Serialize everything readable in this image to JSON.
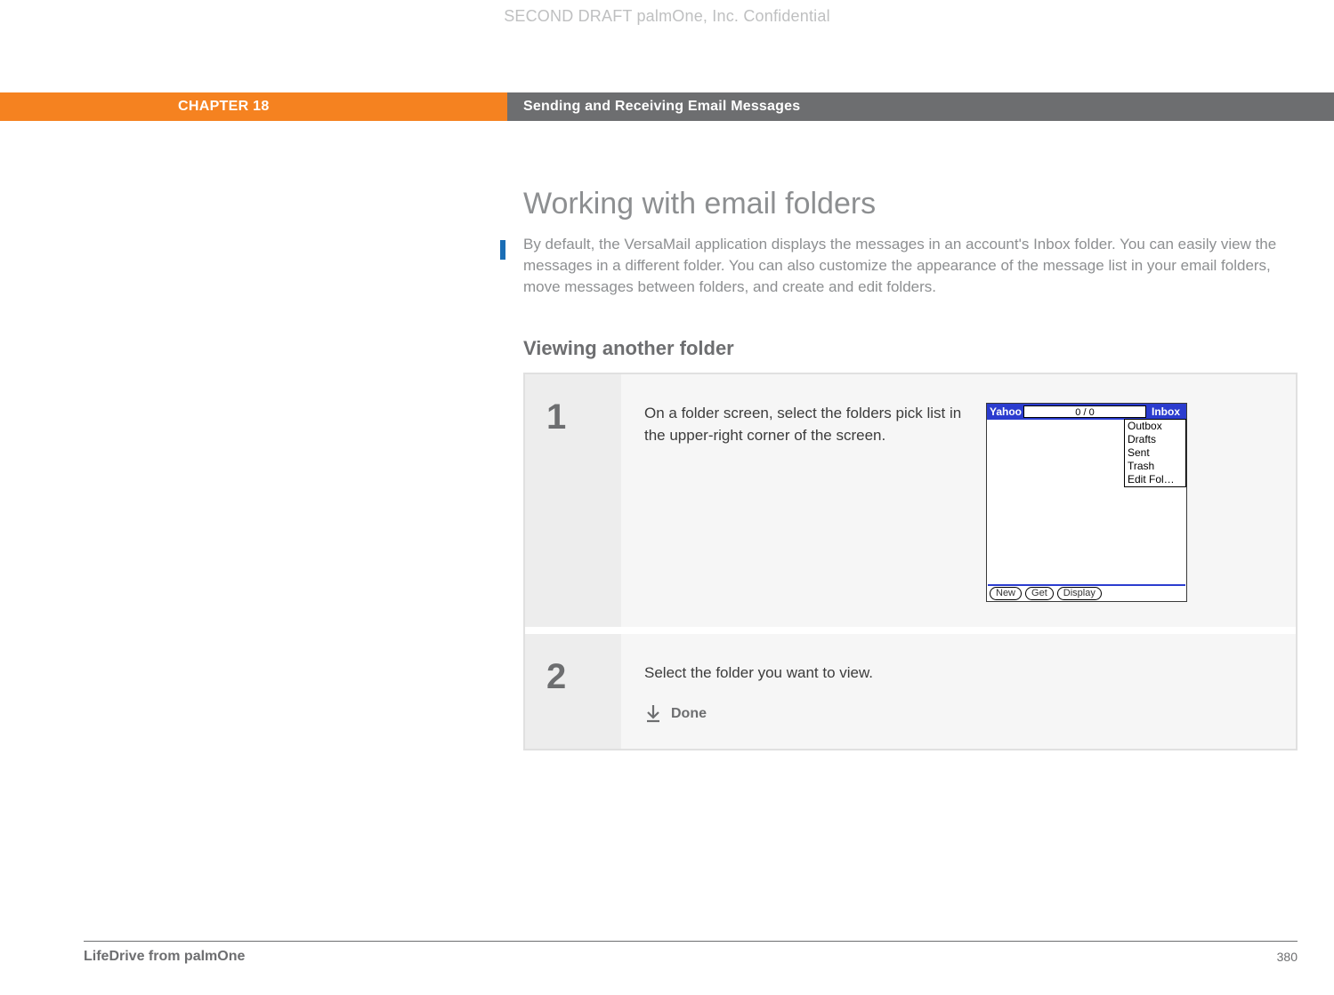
{
  "watermark": "SECOND DRAFT palmOne, Inc.  Confidential",
  "header": {
    "chapter": "CHAPTER 18",
    "section": "Sending and Receiving Email Messages"
  },
  "title": "Working with email folders",
  "intro": "By default, the VersaMail application displays the messages in an account's Inbox folder. You can easily view the messages in a different folder. You can also customize the appearance of the message list in your email folders, move messages between folders, and create and edit folders.",
  "subhead": "Viewing another folder",
  "steps": [
    {
      "num": "1",
      "text": "On a folder screen, select the folders pick list in the upper-right corner of the screen."
    },
    {
      "num": "2",
      "text": "Select the folder you want to view.",
      "done": "Done"
    }
  ],
  "device": {
    "provider": "Yahoo",
    "count": "0 / 0",
    "current_folder": "Inbox",
    "dropdown": [
      "Outbox",
      "Drafts",
      "Sent",
      "Trash",
      "Edit Fol…"
    ],
    "buttons": [
      "New",
      "Get",
      "Display"
    ]
  },
  "footer": {
    "product": "LifeDrive from palmOne",
    "page": "380"
  }
}
